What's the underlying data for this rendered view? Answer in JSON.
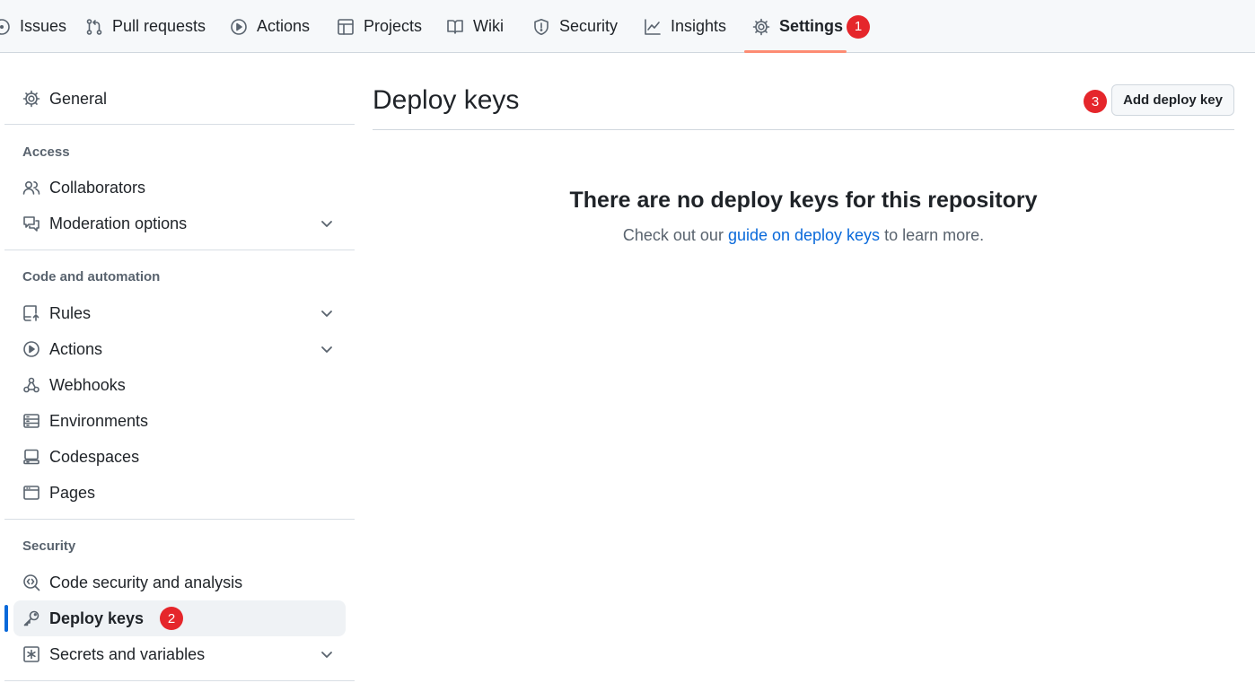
{
  "topnav": {
    "tabs": [
      {
        "label": "Issues",
        "icon": "issue-opened-icon"
      },
      {
        "label": "Pull requests",
        "icon": "git-pull-request-icon"
      },
      {
        "label": "Actions",
        "icon": "play-icon"
      },
      {
        "label": "Projects",
        "icon": "table-icon"
      },
      {
        "label": "Wiki",
        "icon": "book-icon"
      },
      {
        "label": "Security",
        "icon": "shield-icon"
      },
      {
        "label": "Insights",
        "icon": "graph-icon"
      },
      {
        "label": "Settings",
        "icon": "gear-icon",
        "selected": true
      }
    ],
    "settings_badge": "1"
  },
  "sidebar": {
    "general": "General",
    "access_heading": "Access",
    "collaborators": "Collaborators",
    "moderation": "Moderation options",
    "code_heading": "Code and automation",
    "rules": "Rules",
    "actions": "Actions",
    "webhooks": "Webhooks",
    "environments": "Environments",
    "codespaces": "Codespaces",
    "pages": "Pages",
    "security_heading": "Security",
    "code_security": "Code security and analysis",
    "deploy_keys": "Deploy keys",
    "deploy_keys_badge": "2",
    "secrets": "Secrets and variables"
  },
  "main": {
    "title": "Deploy keys",
    "add_button": "Add deploy key",
    "add_button_badge": "3",
    "blank_title": "There are no deploy keys for this repository",
    "blank_desc_prefix": "Check out our ",
    "blank_desc_link": "guide on deploy keys",
    "blank_desc_suffix": " to learn more."
  },
  "colors": {
    "accent": "#0969da",
    "tab_underline": "#fd8c73",
    "step_badge": "#e5262b"
  }
}
